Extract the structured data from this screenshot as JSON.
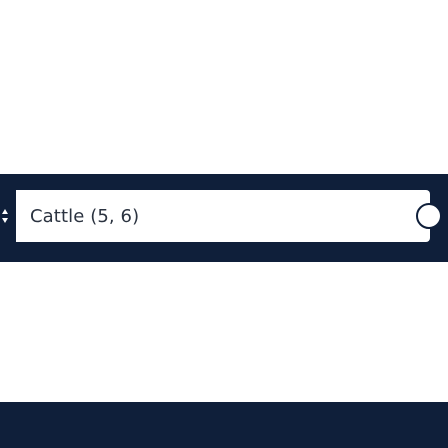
{
  "search": {
    "value": "Cattle (5, 6)"
  },
  "colors": {
    "bar": "#0f1f3a",
    "text": "#2b3340",
    "background": "#ffffff"
  },
  "icons": {
    "left": "sort-arrows-icon",
    "right": "clear-icon"
  }
}
